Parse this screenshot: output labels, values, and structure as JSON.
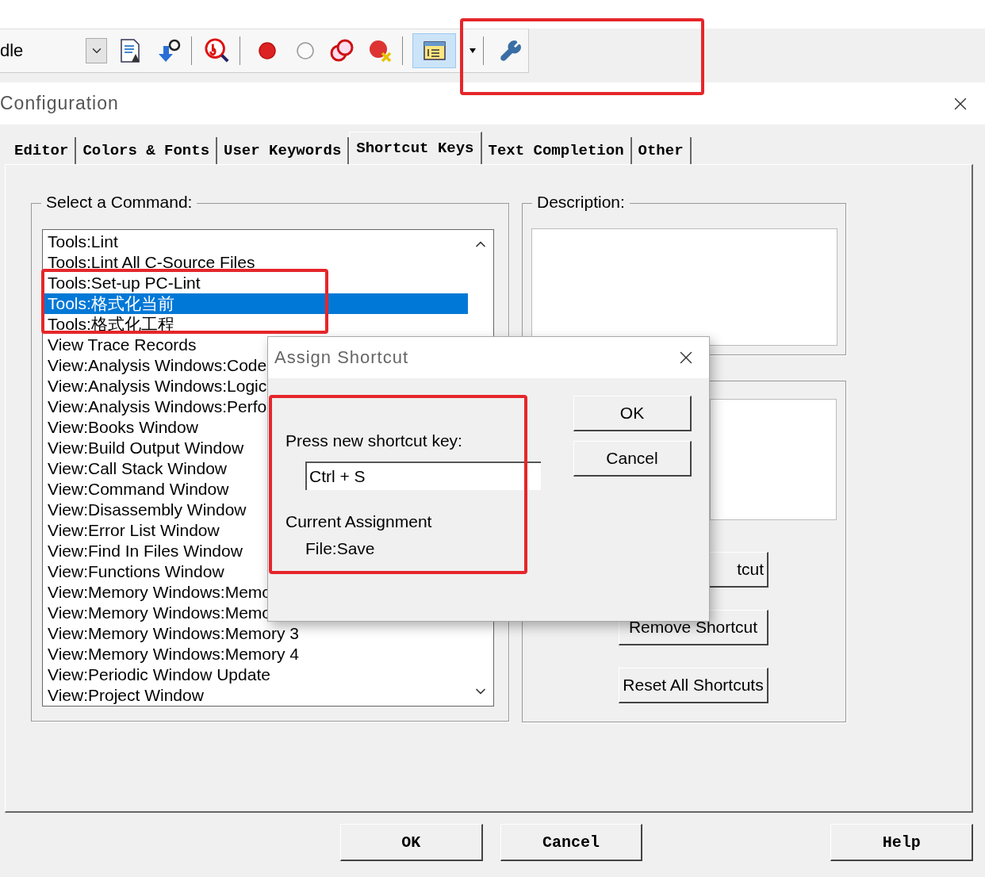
{
  "toolbar": {
    "label": "dle"
  },
  "dialog": {
    "title": "Configuration",
    "tabs": [
      {
        "label": "Editor",
        "selected": false
      },
      {
        "label": "Colors & Fonts",
        "selected": false
      },
      {
        "label": "User Keywords",
        "selected": false
      },
      {
        "label": "Shortcut Keys",
        "selected": true
      },
      {
        "label": "Text Completion",
        "selected": false
      },
      {
        "label": "Other",
        "selected": false
      }
    ],
    "command_group": {
      "label": "Select a Command:",
      "items": [
        {
          "label": "Tools:Lint",
          "selected": false
        },
        {
          "label": "Tools:Lint All C-Source Files",
          "selected": false
        },
        {
          "label": "Tools:Set-up PC-Lint",
          "selected": false
        },
        {
          "label": "Tools:格式化当前",
          "selected": true
        },
        {
          "label": "Tools:格式化工程",
          "selected": false
        },
        {
          "label": "View Trace Records",
          "selected": false
        },
        {
          "label": "View:Analysis Windows:Code",
          "selected": false
        },
        {
          "label": "View:Analysis Windows:Logic",
          "selected": false
        },
        {
          "label": "View:Analysis Windows:Perfo",
          "selected": false
        },
        {
          "label": "View:Books Window",
          "selected": false
        },
        {
          "label": "View:Build Output Window",
          "selected": false
        },
        {
          "label": "View:Call Stack Window",
          "selected": false
        },
        {
          "label": "View:Command Window",
          "selected": false
        },
        {
          "label": "View:Disassembly Window",
          "selected": false
        },
        {
          "label": "View:Error List Window",
          "selected": false
        },
        {
          "label": "View:Find In Files Window",
          "selected": false
        },
        {
          "label": "View:Functions Window",
          "selected": false
        },
        {
          "label": "View:Memory Windows:Memo",
          "selected": false
        },
        {
          "label": "View:Memory Windows:Memo",
          "selected": false
        },
        {
          "label": "View:Memory Windows:Memory 3",
          "selected": false
        },
        {
          "label": "View:Memory Windows:Memory 4",
          "selected": false
        },
        {
          "label": "View:Periodic Window Update",
          "selected": false
        },
        {
          "label": "View:Project Window",
          "selected": false
        }
      ]
    },
    "description_group": {
      "label": "Description:"
    },
    "shortcut_buttons": [
      "tcut",
      "Remove Shortcut",
      "Reset All Shortcuts"
    ],
    "buttons": [
      "OK",
      "Cancel",
      "Help"
    ]
  },
  "assign_shortcut": {
    "title": "Assign Shortcut",
    "prompt": "Press new shortcut key:",
    "value": "Ctrl + S",
    "current_label": "Current Assignment",
    "current_value": "File:Save",
    "buttons": [
      "OK",
      "Cancel"
    ]
  }
}
